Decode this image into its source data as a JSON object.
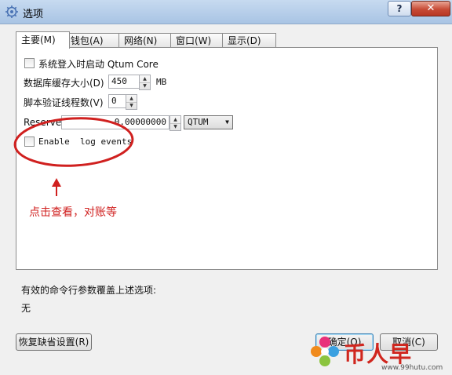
{
  "window": {
    "title": "选项",
    "help_label": "?",
    "close_label": "✕",
    "icon": "qtum-gear-icon"
  },
  "tabs": [
    {
      "label": "主要(M)",
      "active": true
    },
    {
      "label": "钱包(A)",
      "active": false
    },
    {
      "label": "网络(N)",
      "active": false
    },
    {
      "label": "窗口(W)",
      "active": false
    },
    {
      "label": "显示(D)",
      "active": false
    }
  ],
  "main": {
    "start_on_login": {
      "label": "系统登入时启动 Qtum Core",
      "checked": false
    },
    "db_cache": {
      "label": "数据库缓存大小(D)",
      "value": "450",
      "unit": "MB"
    },
    "script_threads": {
      "label": "脚本验证线程数(V)",
      "value": "0"
    },
    "reserve": {
      "label": "Reserve",
      "value": "0.00000000",
      "currency": "QTUM"
    },
    "enable_log_events": {
      "label": "Enable  log events",
      "checked": false
    }
  },
  "annotation": {
    "text": "点击查看，对账等",
    "color": "#d0201f"
  },
  "cmdline": {
    "label": "有效的命令行参数覆盖上述选项:",
    "value": "无"
  },
  "buttons": {
    "reset": "恢复缺省设置(R)",
    "ok": "确定(O)",
    "cancel": "取消(C)"
  },
  "watermark": {
    "text": "币人早",
    "url": "www.99hutu.com"
  }
}
